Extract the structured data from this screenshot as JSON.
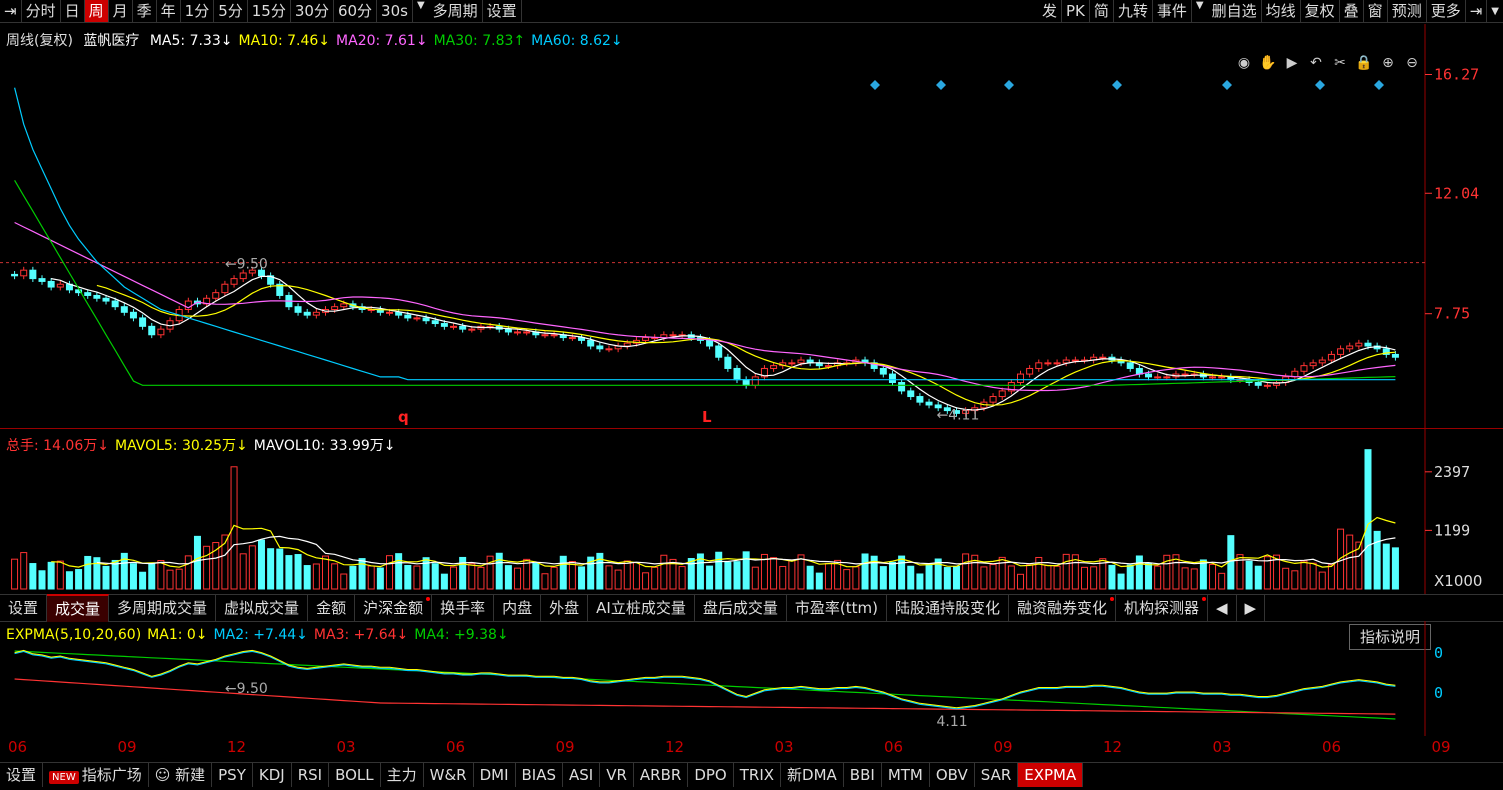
{
  "toolbar": {
    "left": [
      "分时",
      "日",
      "周",
      "月",
      "季",
      "年",
      "1分",
      "5分",
      "15分",
      "30分",
      "60分",
      "30s",
      "多周期",
      "设置"
    ],
    "active": "周",
    "right": [
      "发",
      "PK",
      "简",
      "九转",
      "事件",
      "删自选",
      "均线",
      "复权",
      "叠",
      "窗",
      "预测",
      "更多"
    ]
  },
  "price_legend": {
    "period": "周线(复权)",
    "name": "蓝帆医疗",
    "ma": [
      {
        "label": "MA5: 7.33",
        "arrow": "↓",
        "color": "#ffffff"
      },
      {
        "label": "MA10: 7.46",
        "arrow": "↓",
        "color": "#ffff00"
      },
      {
        "label": "MA20: 7.61",
        "arrow": "↓",
        "color": "#ff66ff"
      },
      {
        "label": "MA30: 7.83",
        "arrow": "↑",
        "color": "#00cc00"
      },
      {
        "label": "MA60: 8.62",
        "arrow": "↓",
        "color": "#00ccff"
      }
    ]
  },
  "vol_legend": [
    {
      "label": "总手: 14.06万",
      "arrow": "↓",
      "color": "#ff3333"
    },
    {
      "label": "MAVOL5: 30.25万",
      "arrow": "↓",
      "color": "#ffff00"
    },
    {
      "label": "MAVOL10: 33.99万",
      "arrow": "↓",
      "color": "#ffffff"
    }
  ],
  "expma_legend": [
    {
      "label": "EXPMA(5,10,20,60)",
      "color": "#ffff00"
    },
    {
      "label": "MA1: 0",
      "arrow": "↓",
      "color": "#ffff00"
    },
    {
      "label": "MA2: +7.44",
      "arrow": "↓",
      "color": "#00ccff"
    },
    {
      "label": "MA3: +7.64",
      "arrow": "↓",
      "color": "#ff3333"
    },
    {
      "label": "MA4: +9.38",
      "arrow": "↓",
      "color": "#00cc00"
    }
  ],
  "tabs": [
    "设置",
    "成交量",
    "多周期成交量",
    "虚拟成交量",
    "金额",
    "沪深金额",
    "换手率",
    "内盘",
    "外盘",
    "AI立桩成交量",
    "盘后成交量",
    "市盈率(ttm)",
    "陆股通持股变化",
    "融资融券变化",
    "机构探测器"
  ],
  "tabs_active": "成交量",
  "tabs_dot": [
    "沪深金额",
    "融资融券变化",
    "机构探测器"
  ],
  "explain_button": "指标说明",
  "bottom": [
    "设置",
    "指标广场",
    "新建",
    "PSY",
    "KDJ",
    "RSI",
    "BOLL",
    "主力",
    "W&R",
    "DMI",
    "BIAS",
    "ASI",
    "VR",
    "ARBR",
    "DPO",
    "TRIX",
    "新DMA",
    "BBI",
    "MTM",
    "OBV",
    "SAR",
    "EXPMA"
  ],
  "bottom_active": "EXPMA",
  "new_badge": "NEW",
  "x_ticks": [
    "06",
    "09",
    "12",
    "03",
    "06",
    "09",
    "12",
    "03",
    "06",
    "09",
    "12",
    "03",
    "06",
    "09"
  ],
  "colors": {
    "up": "#ff3333",
    "down": "#55ffff",
    "grid": "#990000"
  },
  "chart_data": [
    {
      "type": "candlestick",
      "yticks": [
        16.27,
        12.04,
        7.75
      ],
      "ylim": [
        4.0,
        17.0
      ],
      "annotations": [
        {
          "text": "9.50",
          "at": "high"
        },
        {
          "text": "4.11",
          "at": "low"
        }
      ],
      "marks": [
        "q",
        "L"
      ],
      "close": [
        9.1,
        9.3,
        9.0,
        8.9,
        8.7,
        8.8,
        8.6,
        8.5,
        8.4,
        8.3,
        8.2,
        8.0,
        7.8,
        7.6,
        7.3,
        7.0,
        7.2,
        7.5,
        7.9,
        8.2,
        8.1,
        8.3,
        8.5,
        8.8,
        9.0,
        9.2,
        9.3,
        9.1,
        8.8,
        8.4,
        8.0,
        7.8,
        7.7,
        7.8,
        7.9,
        8.0,
        8.1,
        8.0,
        7.9,
        7.9,
        7.8,
        7.8,
        7.7,
        7.6,
        7.6,
        7.5,
        7.4,
        7.3,
        7.3,
        7.2,
        7.2,
        7.3,
        7.3,
        7.2,
        7.1,
        7.1,
        7.1,
        7.0,
        7.0,
        7.0,
        6.9,
        6.9,
        6.8,
        6.6,
        6.5,
        6.5,
        6.6,
        6.7,
        6.8,
        6.9,
        6.9,
        7.0,
        7.0,
        7.0,
        6.9,
        6.8,
        6.6,
        6.2,
        5.8,
        5.4,
        5.2,
        5.5,
        5.8,
        5.9,
        6.0,
        6.0,
        6.1,
        6.0,
        5.9,
        5.9,
        6.0,
        6.0,
        6.1,
        6.0,
        5.8,
        5.6,
        5.3,
        5.0,
        4.8,
        4.6,
        4.5,
        4.4,
        4.3,
        4.2,
        4.3,
        4.4,
        4.6,
        4.8,
        5.0,
        5.3,
        5.6,
        5.8,
        6.0,
        6.0,
        6.0,
        6.1,
        6.1,
        6.1,
        6.2,
        6.2,
        6.1,
        6.0,
        5.8,
        5.6,
        5.5,
        5.5,
        5.5,
        5.6,
        5.6,
        5.6,
        5.5,
        5.5,
        5.5,
        5.4,
        5.4,
        5.3,
        5.2,
        5.2,
        5.3,
        5.5,
        5.7,
        5.9,
        6.0,
        6.1,
        6.3,
        6.5,
        6.6,
        6.7,
        6.6,
        6.5,
        6.3,
        6.2
      ],
      "ma_periods": [
        5,
        10,
        20,
        30,
        60
      ],
      "ma_colors": [
        "#ffffff",
        "#ffff00",
        "#ff66ff",
        "#00cc00",
        "#00ccff"
      ],
      "ma60_start": [
        15.8,
        14.5,
        13.6,
        12.9,
        12.2,
        11.5,
        10.9,
        10.4,
        10.0,
        9.6,
        9.3,
        9.0,
        8.7,
        8.5,
        8.3,
        8.1,
        7.9,
        7.8,
        7.7,
        7.6,
        7.5,
        7.4,
        7.3,
        7.2,
        7.1,
        7.0,
        6.9,
        6.8,
        6.7,
        6.6,
        6.5,
        6.4,
        6.3,
        6.2,
        6.1,
        6.0,
        5.9,
        5.8,
        5.7,
        5.6,
        5.5,
        5.5,
        5.5,
        5.4,
        5.4,
        5.4,
        5.4,
        5.4,
        5.4,
        5.4
      ]
    },
    {
      "type": "bar",
      "yticks": [
        2397,
        1199
      ],
      "unit": "X1000",
      "ylim": [
        0,
        2700
      ]
    },
    {
      "type": "line",
      "yticks": [
        0,
        0
      ],
      "annotations": [
        {
          "text": "9.50"
        },
        {
          "text": "4.11"
        }
      ]
    }
  ]
}
